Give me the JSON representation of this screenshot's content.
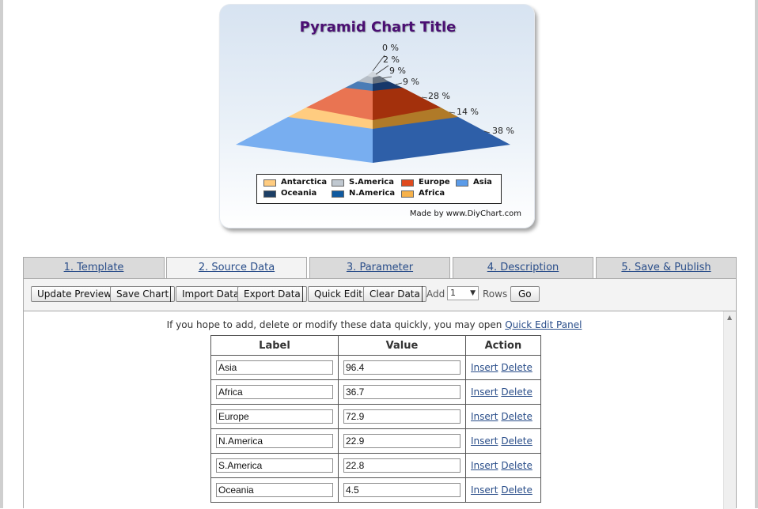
{
  "chart": {
    "title": "Pyramid Chart Title",
    "made_by": "Made by www.DiyChart.com"
  },
  "chart_data": {
    "type": "pyramid",
    "title": "Pyramid Chart Title",
    "layers_top_to_bottom": [
      {
        "label": "0 %",
        "value": 0
      },
      {
        "label": "2 %",
        "value": 2
      },
      {
        "label": "9 %",
        "value": 9
      },
      {
        "label": "9 %",
        "value": 9
      },
      {
        "label": "28 %",
        "value": 28
      },
      {
        "label": "14 %",
        "value": 14
      },
      {
        "label": "38 %",
        "value": 38
      }
    ],
    "legend": [
      {
        "name": "Antarctica",
        "color": "#ffcc80"
      },
      {
        "name": "S.America",
        "color": "#c0c8d0"
      },
      {
        "name": "Europe",
        "color": "#e04a1e"
      },
      {
        "name": "Asia",
        "color": "#5b9be8"
      },
      {
        "name": "Oceania",
        "color": "#1d3f66"
      },
      {
        "name": "N.America",
        "color": "#0f5aa0"
      },
      {
        "name": "Africa",
        "color": "#f7b24a"
      }
    ],
    "legend_placement": "bottom"
  },
  "tabs": [
    {
      "label": "1. Template",
      "active": false
    },
    {
      "label": "2. Source Data",
      "active": true
    },
    {
      "label": "3. Parameter",
      "active": false
    },
    {
      "label": "4. Description",
      "active": false
    },
    {
      "label": "5. Save & Publish",
      "active": false
    }
  ],
  "toolbar": {
    "update_preview": "Update Preview",
    "save_chart": "Save Chart",
    "import_data": "Import Data",
    "export_data": "Export Data",
    "quick_edit": "Quick Edit",
    "clear_data": "Clear Data",
    "add_label": "Add",
    "rows_value": "1",
    "rows_label": "Rows",
    "go": "Go"
  },
  "hint": {
    "text": "If you hope to add, delete or modify these data quickly, you may open",
    "link": "Quick Edit Panel"
  },
  "table": {
    "headers": [
      "Label",
      "Value",
      "Action"
    ],
    "insert_label": "Insert",
    "delete_label": "Delete",
    "rows": [
      {
        "label": "Asia",
        "value": "96.4"
      },
      {
        "label": "Africa",
        "value": "36.7"
      },
      {
        "label": "Europe",
        "value": "72.9"
      },
      {
        "label": "N.America",
        "value": "22.9"
      },
      {
        "label": "S.America",
        "value": "22.8"
      },
      {
        "label": "Oceania",
        "value": "4.5"
      }
    ]
  }
}
